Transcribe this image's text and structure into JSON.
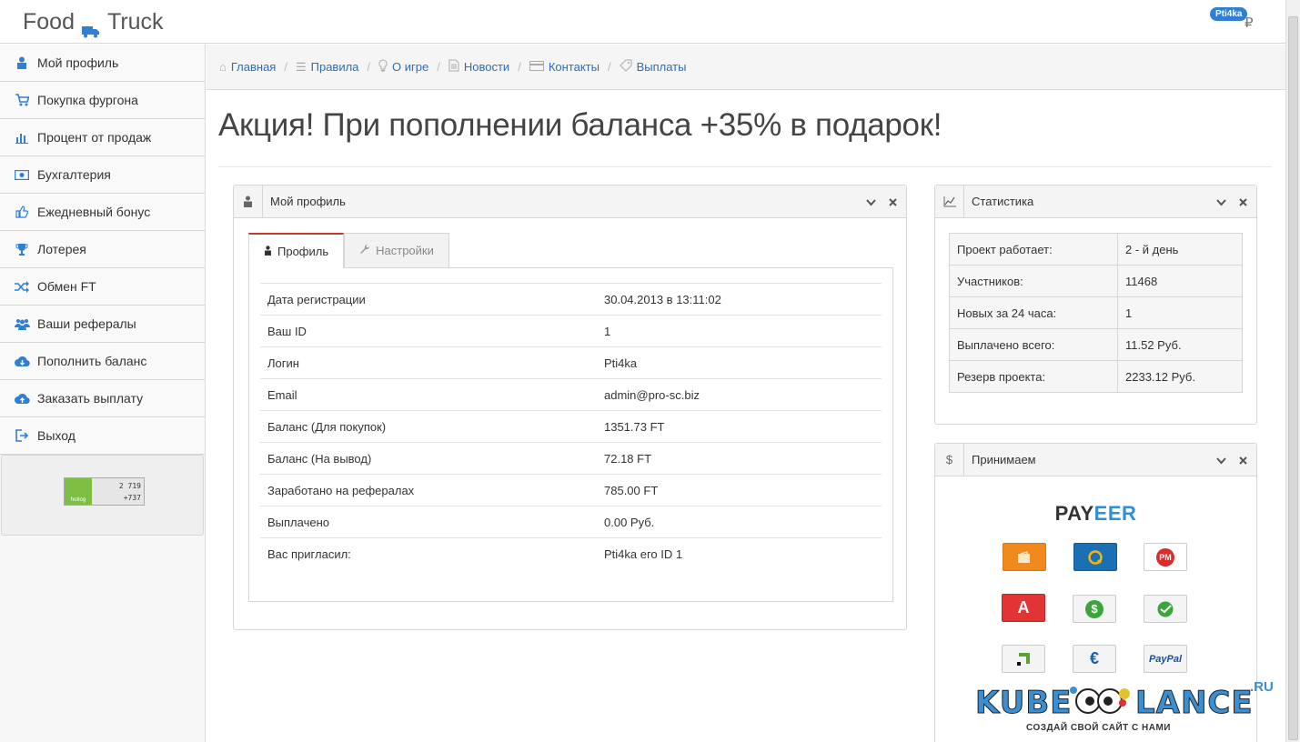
{
  "brand": {
    "word1": "Food",
    "word2": "Truck"
  },
  "header": {
    "user_badge": "Pti4ka",
    "currency_sign": "₽"
  },
  "sidebar": {
    "items": [
      {
        "label": "Мой профиль",
        "icon": "user-icon"
      },
      {
        "label": "Покупка фургона",
        "icon": "cart-icon"
      },
      {
        "label": "Процент от продаж",
        "icon": "bar-chart-icon"
      },
      {
        "label": "Бухгалтерия",
        "icon": "money-icon"
      },
      {
        "label": "Ежедневный бонус",
        "icon": "thumbs-up-icon"
      },
      {
        "label": "Лотерея",
        "icon": "trophy-icon"
      },
      {
        "label": "Обмен FT",
        "icon": "shuffle-icon"
      },
      {
        "label": "Ваши рефералы",
        "icon": "users-icon"
      },
      {
        "label": "Пополнить баланс",
        "icon": "cloud-download-icon"
      },
      {
        "label": "Заказать выплату",
        "icon": "cloud-upload-icon"
      },
      {
        "label": "Выход",
        "icon": "logout-icon"
      }
    ],
    "counter": {
      "brand": "hotlog",
      "line1": "2 719",
      "line2": "+737"
    }
  },
  "breadcrumb": [
    {
      "label": "Главная",
      "icon": "home-icon"
    },
    {
      "label": "Правила",
      "icon": "list-icon"
    },
    {
      "label": "О игре",
      "icon": "lightbulb-icon"
    },
    {
      "label": "Новости",
      "icon": "document-icon"
    },
    {
      "label": "Контакты",
      "icon": "card-icon"
    },
    {
      "label": "Выплаты",
      "icon": "tag-icon"
    }
  ],
  "page_title": "Акция! При пополнении баланса +35% в подарок!",
  "profile_panel": {
    "title": "Мой профиль",
    "tabs": [
      {
        "label": "Профиль",
        "active": true
      },
      {
        "label": "Настройки",
        "active": false
      }
    ],
    "rows": [
      {
        "key": "Дата регистрации",
        "value": "30.04.2013 в 13:11:02"
      },
      {
        "key": "Ваш ID",
        "value": "1"
      },
      {
        "key": "Логин",
        "value": "Pti4ka"
      },
      {
        "key": "Email",
        "value": "admin@pro-sc.biz"
      },
      {
        "key": "Баланс (Для покупок)",
        "value": "1351.73 FT"
      },
      {
        "key": "Баланс (На вывод)",
        "value": "72.18 FT"
      },
      {
        "key": "Заработано на рефералах",
        "value": "785.00 FT"
      },
      {
        "key": "Выплачено",
        "value": "0.00 Руб."
      },
      {
        "key": "Вас пригласил:",
        "value": "Pti4ka его ID 1"
      }
    ]
  },
  "stats_panel": {
    "title": "Статистика",
    "rows": [
      {
        "key": "Проект работает:",
        "value": "2 - й день"
      },
      {
        "key": "Участников:",
        "value": "11468"
      },
      {
        "key": "Новых за 24 часа:",
        "value": "1"
      },
      {
        "key": "Выплачено всего:",
        "value": "11.52 Руб."
      },
      {
        "key": "Резерв проекта:",
        "value": "2233.12 Руб."
      }
    ]
  },
  "accept_panel": {
    "title": "Принимаем",
    "icon_sign": "$",
    "payeer_part1": "PAY",
    "payeer_part2": "EER",
    "methods": [
      {
        "icon": "yandex-money-icon",
        "text": "",
        "bg": "#f08a1d",
        "fg": "#ffffff"
      },
      {
        "icon": "qiwi-icon",
        "text": "",
        "bg": "#1a6fb5",
        "fg": "#ffffff"
      },
      {
        "icon": "perfect-money-icon",
        "text": "PM",
        "bg": "#ffffff",
        "fg": "#d92d2d"
      },
      {
        "icon": "alfa-bank-icon",
        "text": "А",
        "bg": "#e23434",
        "fg": "#ffffff"
      },
      {
        "icon": "dollar-coin-icon",
        "text": "$",
        "bg": "#f4f4f4",
        "fg": "#3aa53a"
      },
      {
        "icon": "sberbank-icon",
        "text": "",
        "bg": "#f4f4f4",
        "fg": "#3aa53a"
      },
      {
        "icon": "privatbank-icon",
        "text": "",
        "bg": "#f4f4f4",
        "fg": "#5ba235"
      },
      {
        "icon": "euroset-icon",
        "text": "€",
        "bg": "#f4f4f4",
        "fg": "#1d5fa8"
      },
      {
        "icon": "paypal-icon",
        "text": "PayPal",
        "bg": "#f4f4f4",
        "fg": "#1d4f9a"
      }
    ]
  },
  "watermark": {
    "word1": "KUBE",
    "word2": "LANCE",
    "ru": ".RU",
    "tagline": "СОЗДАЙ СВОЙ САЙТ С НАМИ"
  },
  "colors": {
    "link": "#2a6fb8",
    "accent": "#2f7fd3",
    "tab_active_border": "#c0392b"
  }
}
